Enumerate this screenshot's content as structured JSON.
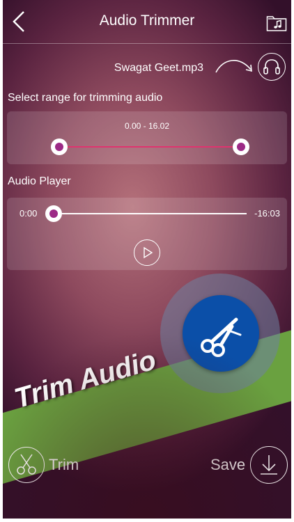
{
  "header": {
    "title": "Audio Trimmer",
    "back_icon": "chevron-left-icon",
    "folder_icon": "music-folder-icon"
  },
  "file": {
    "name": "Swagat Geet.mp3"
  },
  "range": {
    "label": "Select range for trimming audio",
    "value": "0.00 - 16.02",
    "start_fraction": 0.0,
    "end_fraction": 1.0,
    "track_color": "#e0336f",
    "thumb_color": "#9c2a86"
  },
  "player": {
    "label": "Audio Player",
    "time_start": "0:00",
    "time_end": "-16:03",
    "progress_fraction": 0.0
  },
  "banner": {
    "text": "Trim Audio",
    "color": "#6aa140"
  },
  "fab": {
    "icon": "scissors-icon",
    "color": "#0b4fa8"
  },
  "footer": {
    "trim_label": "Trim",
    "save_label": "Save"
  }
}
